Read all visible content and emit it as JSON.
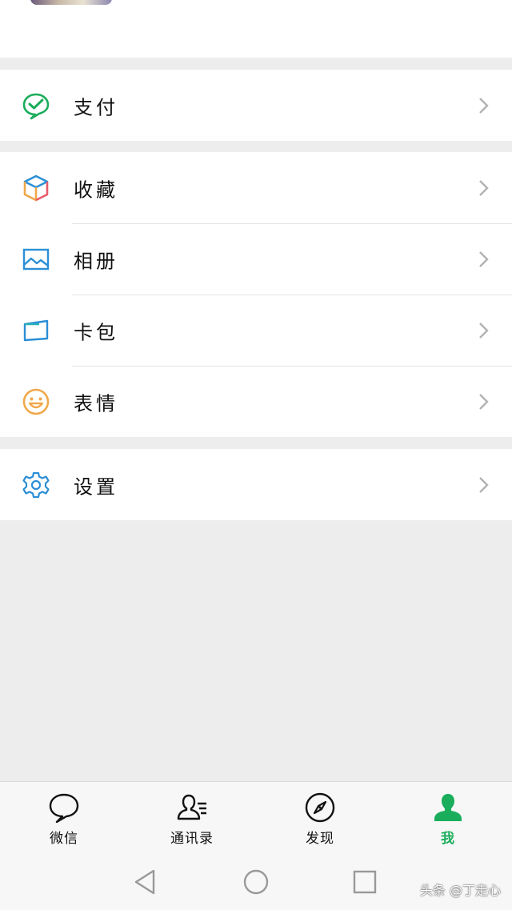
{
  "menu": {
    "pay": {
      "label": "支付",
      "icon": "pay-check-icon"
    },
    "group2": [
      {
        "label": "收藏",
        "icon": "favorites-cube-icon"
      },
      {
        "label": "相册",
        "icon": "album-picture-icon"
      },
      {
        "label": "卡包",
        "icon": "card-wallet-icon"
      },
      {
        "label": "表情",
        "icon": "smiley-face-icon"
      }
    ],
    "settings": {
      "label": "设置",
      "icon": "gear-icon"
    }
  },
  "tabbar": {
    "tabs": [
      {
        "label": "微信",
        "icon": "chat-bubble-icon"
      },
      {
        "label": "通讯录",
        "icon": "contacts-icon"
      },
      {
        "label": "发现",
        "icon": "compass-icon"
      },
      {
        "label": "我",
        "icon": "person-icon",
        "active": true
      }
    ]
  },
  "colors": {
    "accent": "#1aad5b",
    "background": "#ededed"
  },
  "watermark": "头条 @丁走心"
}
